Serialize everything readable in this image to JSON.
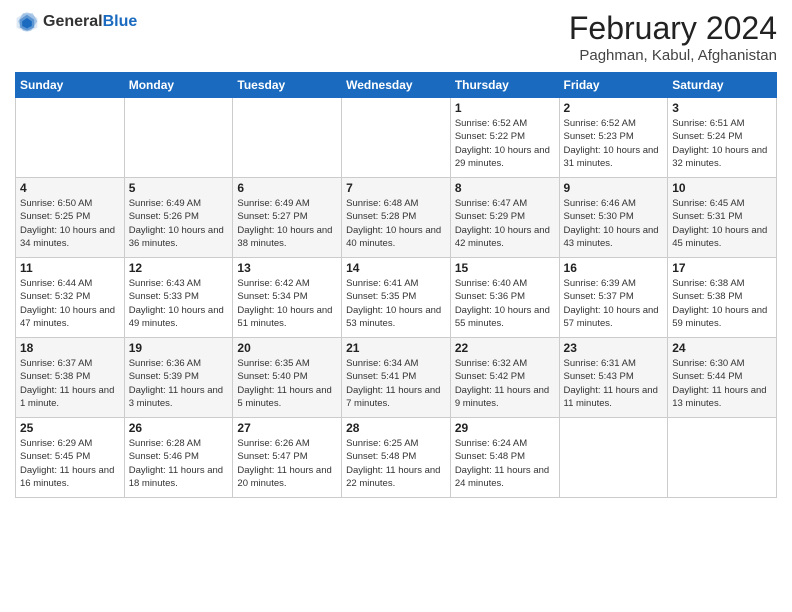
{
  "header": {
    "logo_general": "General",
    "logo_blue": "Blue",
    "month_year": "February 2024",
    "location": "Paghman, Kabul, Afghanistan"
  },
  "days_of_week": [
    "Sunday",
    "Monday",
    "Tuesday",
    "Wednesday",
    "Thursday",
    "Friday",
    "Saturday"
  ],
  "weeks": [
    [
      {
        "day": "",
        "info": ""
      },
      {
        "day": "",
        "info": ""
      },
      {
        "day": "",
        "info": ""
      },
      {
        "day": "",
        "info": ""
      },
      {
        "day": "1",
        "info": "Sunrise: 6:52 AM\nSunset: 5:22 PM\nDaylight: 10 hours\nand 29 minutes."
      },
      {
        "day": "2",
        "info": "Sunrise: 6:52 AM\nSunset: 5:23 PM\nDaylight: 10 hours\nand 31 minutes."
      },
      {
        "day": "3",
        "info": "Sunrise: 6:51 AM\nSunset: 5:24 PM\nDaylight: 10 hours\nand 32 minutes."
      }
    ],
    [
      {
        "day": "4",
        "info": "Sunrise: 6:50 AM\nSunset: 5:25 PM\nDaylight: 10 hours\nand 34 minutes."
      },
      {
        "day": "5",
        "info": "Sunrise: 6:49 AM\nSunset: 5:26 PM\nDaylight: 10 hours\nand 36 minutes."
      },
      {
        "day": "6",
        "info": "Sunrise: 6:49 AM\nSunset: 5:27 PM\nDaylight: 10 hours\nand 38 minutes."
      },
      {
        "day": "7",
        "info": "Sunrise: 6:48 AM\nSunset: 5:28 PM\nDaylight: 10 hours\nand 40 minutes."
      },
      {
        "day": "8",
        "info": "Sunrise: 6:47 AM\nSunset: 5:29 PM\nDaylight: 10 hours\nand 42 minutes."
      },
      {
        "day": "9",
        "info": "Sunrise: 6:46 AM\nSunset: 5:30 PM\nDaylight: 10 hours\nand 43 minutes."
      },
      {
        "day": "10",
        "info": "Sunrise: 6:45 AM\nSunset: 5:31 PM\nDaylight: 10 hours\nand 45 minutes."
      }
    ],
    [
      {
        "day": "11",
        "info": "Sunrise: 6:44 AM\nSunset: 5:32 PM\nDaylight: 10 hours\nand 47 minutes."
      },
      {
        "day": "12",
        "info": "Sunrise: 6:43 AM\nSunset: 5:33 PM\nDaylight: 10 hours\nand 49 minutes."
      },
      {
        "day": "13",
        "info": "Sunrise: 6:42 AM\nSunset: 5:34 PM\nDaylight: 10 hours\nand 51 minutes."
      },
      {
        "day": "14",
        "info": "Sunrise: 6:41 AM\nSunset: 5:35 PM\nDaylight: 10 hours\nand 53 minutes."
      },
      {
        "day": "15",
        "info": "Sunrise: 6:40 AM\nSunset: 5:36 PM\nDaylight: 10 hours\nand 55 minutes."
      },
      {
        "day": "16",
        "info": "Sunrise: 6:39 AM\nSunset: 5:37 PM\nDaylight: 10 hours\nand 57 minutes."
      },
      {
        "day": "17",
        "info": "Sunrise: 6:38 AM\nSunset: 5:38 PM\nDaylight: 10 hours\nand 59 minutes."
      }
    ],
    [
      {
        "day": "18",
        "info": "Sunrise: 6:37 AM\nSunset: 5:38 PM\nDaylight: 11 hours\nand 1 minute."
      },
      {
        "day": "19",
        "info": "Sunrise: 6:36 AM\nSunset: 5:39 PM\nDaylight: 11 hours\nand 3 minutes."
      },
      {
        "day": "20",
        "info": "Sunrise: 6:35 AM\nSunset: 5:40 PM\nDaylight: 11 hours\nand 5 minutes."
      },
      {
        "day": "21",
        "info": "Sunrise: 6:34 AM\nSunset: 5:41 PM\nDaylight: 11 hours\nand 7 minutes."
      },
      {
        "day": "22",
        "info": "Sunrise: 6:32 AM\nSunset: 5:42 PM\nDaylight: 11 hours\nand 9 minutes."
      },
      {
        "day": "23",
        "info": "Sunrise: 6:31 AM\nSunset: 5:43 PM\nDaylight: 11 hours\nand 11 minutes."
      },
      {
        "day": "24",
        "info": "Sunrise: 6:30 AM\nSunset: 5:44 PM\nDaylight: 11 hours\nand 13 minutes."
      }
    ],
    [
      {
        "day": "25",
        "info": "Sunrise: 6:29 AM\nSunset: 5:45 PM\nDaylight: 11 hours\nand 16 minutes."
      },
      {
        "day": "26",
        "info": "Sunrise: 6:28 AM\nSunset: 5:46 PM\nDaylight: 11 hours\nand 18 minutes."
      },
      {
        "day": "27",
        "info": "Sunrise: 6:26 AM\nSunset: 5:47 PM\nDaylight: 11 hours\nand 20 minutes."
      },
      {
        "day": "28",
        "info": "Sunrise: 6:25 AM\nSunset: 5:48 PM\nDaylight: 11 hours\nand 22 minutes."
      },
      {
        "day": "29",
        "info": "Sunrise: 6:24 AM\nSunset: 5:48 PM\nDaylight: 11 hours\nand 24 minutes."
      },
      {
        "day": "",
        "info": ""
      },
      {
        "day": "",
        "info": ""
      }
    ]
  ]
}
